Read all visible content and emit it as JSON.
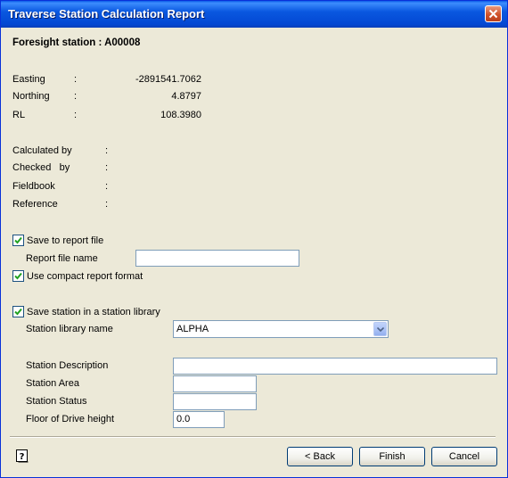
{
  "window": {
    "title": "Traverse Station Calculation Report",
    "close_icon": "close-icon"
  },
  "header": {
    "foresight_label": "Foresight station : A00008"
  },
  "coordinates": [
    {
      "label": "Easting",
      "sep": ":",
      "value": "-2891541.7062"
    },
    {
      "label": "Northing",
      "sep": ":",
      "value": "4.8797"
    },
    {
      "label": "RL",
      "sep": ":",
      "value": "108.3980"
    }
  ],
  "info": [
    {
      "label": "Calculated by",
      "sep": ":"
    },
    {
      "label": "Checked   by",
      "sep": ":"
    },
    {
      "label": "Fieldbook",
      "sep": ":"
    },
    {
      "label": "Reference",
      "sep": ":"
    }
  ],
  "report": {
    "save_label": "Save to report file",
    "save_checked": true,
    "file_name_label": "Report file name",
    "file_name_value": "",
    "compact_label": "Use compact report format",
    "compact_checked": true
  },
  "library": {
    "save_label": "Save station in a station library",
    "save_checked": true,
    "library_name_label": "Station library name",
    "library_name_value": "ALPHA",
    "description_label": "Station Description",
    "description_value": "",
    "area_label": "Station Area",
    "area_value": "",
    "status_label": "Station Status",
    "status_value": "",
    "floor_label": "Floor of Drive height",
    "floor_value": "0.0"
  },
  "buttons": {
    "back": "< Back",
    "finish": "Finish",
    "cancel": "Cancel"
  },
  "colors": {
    "title_bar": "#0a58e0",
    "dialog_bg": "#ece9d8",
    "close_button": "#d1532b"
  }
}
